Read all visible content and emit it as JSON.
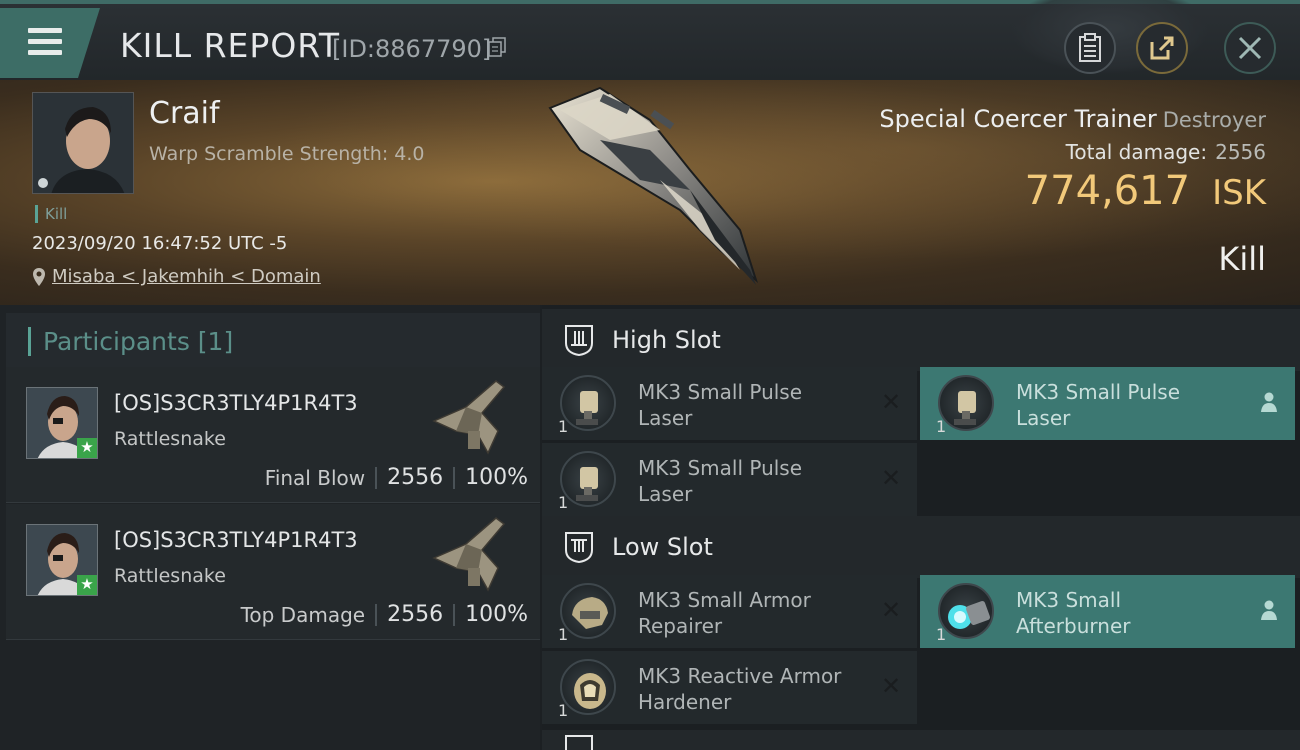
{
  "header": {
    "title": "KILL REPORT",
    "report_id": "[ID:8867790]"
  },
  "victim": {
    "name": "Craif",
    "warp_scramble": "Warp Scramble Strength: 4.0",
    "tag": "Kill",
    "datetime": "2023/09/20 16:47:52 UTC -5",
    "location": "Misaba < Jakemhih < Domain",
    "ship_name": "Special Coercer Trainer",
    "ship_class": "Destroyer",
    "total_damage_label": "Total damage:",
    "total_damage": "2556",
    "isk_value": "774,617",
    "isk_unit": "ISK",
    "result": "Kill"
  },
  "participants": {
    "header": "Participants [1]",
    "rows": [
      {
        "name": "[OS]S3CR3TLY4P1R4T3",
        "ship": "Rattlesnake",
        "role": "Final Blow",
        "damage": "2556",
        "percent": "100%"
      },
      {
        "name": "[OS]S3CR3TLY4P1R4T3",
        "ship": "Rattlesnake",
        "role": "Top Damage",
        "damage": "2556",
        "percent": "100%"
      }
    ]
  },
  "slots": {
    "high_label": "High Slot",
    "low_label": "Low Slot",
    "high": [
      {
        "name": "MK3 Small Pulse Laser",
        "qty": "1",
        "status": "destroyed"
      },
      {
        "name": "MK3 Small Pulse Laser",
        "qty": "1",
        "status": "dropped"
      },
      {
        "name": "MK3 Small Pulse Laser",
        "qty": "1",
        "status": "destroyed"
      }
    ],
    "low": [
      {
        "name": "MK3 Small Armor Repairer",
        "qty": "1",
        "status": "destroyed"
      },
      {
        "name": "MK3 Small Afterburner",
        "qty": "1",
        "status": "dropped"
      },
      {
        "name": "MK3 Reactive Armor Hardener",
        "qty": "1",
        "status": "destroyed"
      }
    ]
  },
  "colors": {
    "accent_teal": "#3c7872",
    "isk_gold": "#f2c97a"
  },
  "icons": [
    "menu-icon",
    "copy-icon",
    "clipboard-icon",
    "share-icon",
    "close-icon",
    "location-pin-icon",
    "high-slot-icon",
    "low-slot-icon",
    "destroyed-x-icon",
    "dropped-person-icon"
  ]
}
